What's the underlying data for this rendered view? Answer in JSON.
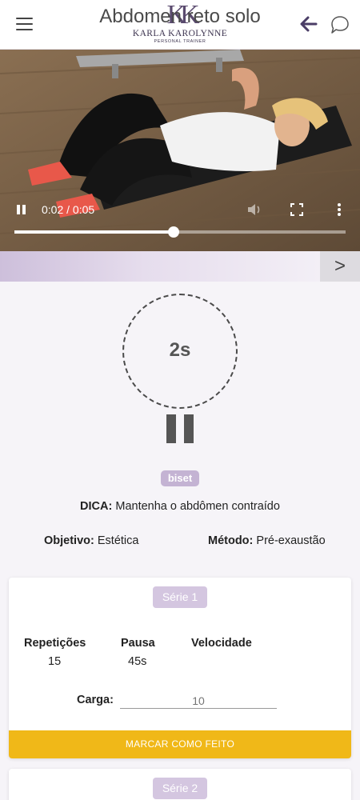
{
  "header": {
    "logo_mark": "KK",
    "logo_name": "KARLA KAROLYNNE",
    "logo_sub": "PERSONAL TRAINER",
    "menu_icon": "hamburger-menu-icon",
    "back_icon": "arrow-left-icon",
    "chat_icon": "chat-bubble-icon"
  },
  "video": {
    "current_time": "0:02",
    "duration": "0:05",
    "time_display": "0:02 / 0:05",
    "progress": 0.48,
    "icons": [
      "pause-icon",
      "volume-icon",
      "fullscreen-icon",
      "more-vert-icon"
    ]
  },
  "exercise": {
    "title": "Abdomen reto solo",
    "next_label": ">",
    "timer": "2s",
    "badge": "biset",
    "tip_label": "DICA:",
    "tip_text": "Mantenha o abdômen contraído",
    "objective_label": "Objetivo:",
    "objective_value": "Estética",
    "method_label": "Método:",
    "method_value": "Pré-exaustão"
  },
  "series": [
    {
      "label": "Série 1",
      "reps_label": "Repetições",
      "reps_value": "15",
      "pause_label": "Pausa",
      "pause_value": "45s",
      "speed_label": "Velocidade",
      "speed_value": "",
      "load_label": "Carga:",
      "load_placeholder": "10",
      "done_label": "MARCAR COMO FEITO"
    },
    {
      "label": "Série 2"
    }
  ],
  "colors": {
    "accent_purple": "#c4b3d3",
    "done_yellow": "#f0b818",
    "brand_dark": "#3d3450"
  }
}
